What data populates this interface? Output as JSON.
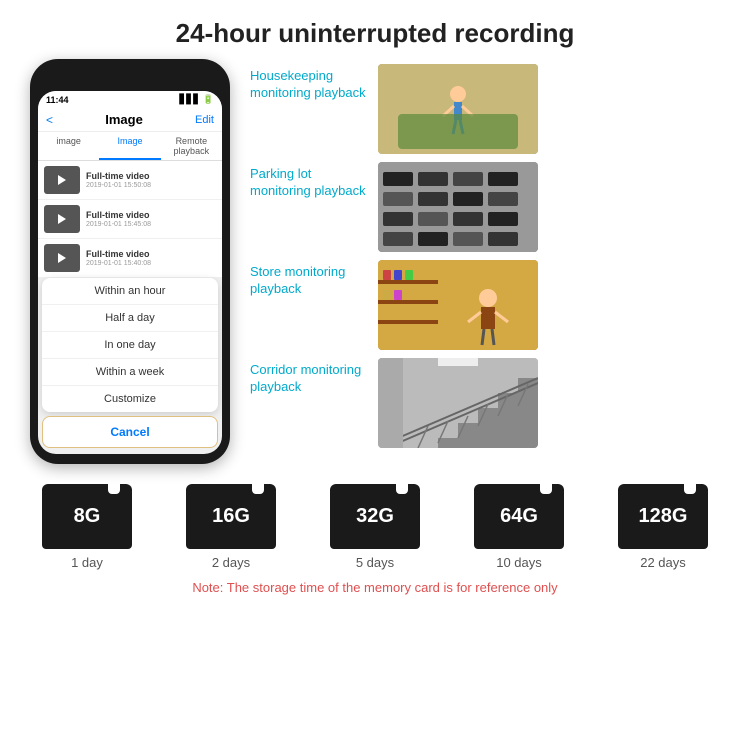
{
  "header": {
    "title": "24-hour uninterrupted recording"
  },
  "phone": {
    "time": "11:44",
    "screen_title": "Image",
    "edit_label": "Edit",
    "back_label": "<",
    "tabs": [
      {
        "label": "image",
        "active": false
      },
      {
        "label": "Image",
        "active": true
      },
      {
        "label": "Remote playback",
        "active": false
      }
    ],
    "videos": [
      {
        "title": "Full-time video",
        "date": "2019-01-01 15:50:08"
      },
      {
        "title": "Full-time video",
        "date": "2019-01-01 15:45:08"
      },
      {
        "title": "Full-time video",
        "date": "2019-01-01 15:40:08"
      }
    ],
    "menu_items": [
      {
        "label": "Within an hour"
      },
      {
        "label": "Half a day"
      },
      {
        "label": "In one day"
      },
      {
        "label": "Within a week"
      },
      {
        "label": "Customize"
      }
    ],
    "cancel_label": "Cancel"
  },
  "monitoring": [
    {
      "label": "Housekeeping\nmonitoring playback",
      "img_class": "img-housekeeping"
    },
    {
      "label": "Parking lot\nmonitoring playback",
      "img_class": "img-parking"
    },
    {
      "label": "Store monitoring\nplayback",
      "img_class": "img-store"
    },
    {
      "label": "Corridor monitoring\nplayback",
      "img_class": "img-corridor"
    }
  ],
  "sd_cards": [
    {
      "size": "8G",
      "days": "1 day"
    },
    {
      "size": "16G",
      "days": "2 days"
    },
    {
      "size": "32G",
      "days": "5 days"
    },
    {
      "size": "64G",
      "days": "10 days"
    },
    {
      "size": "128G",
      "days": "22 days"
    }
  ],
  "note": "Note: The storage time of the memory card is for reference only"
}
